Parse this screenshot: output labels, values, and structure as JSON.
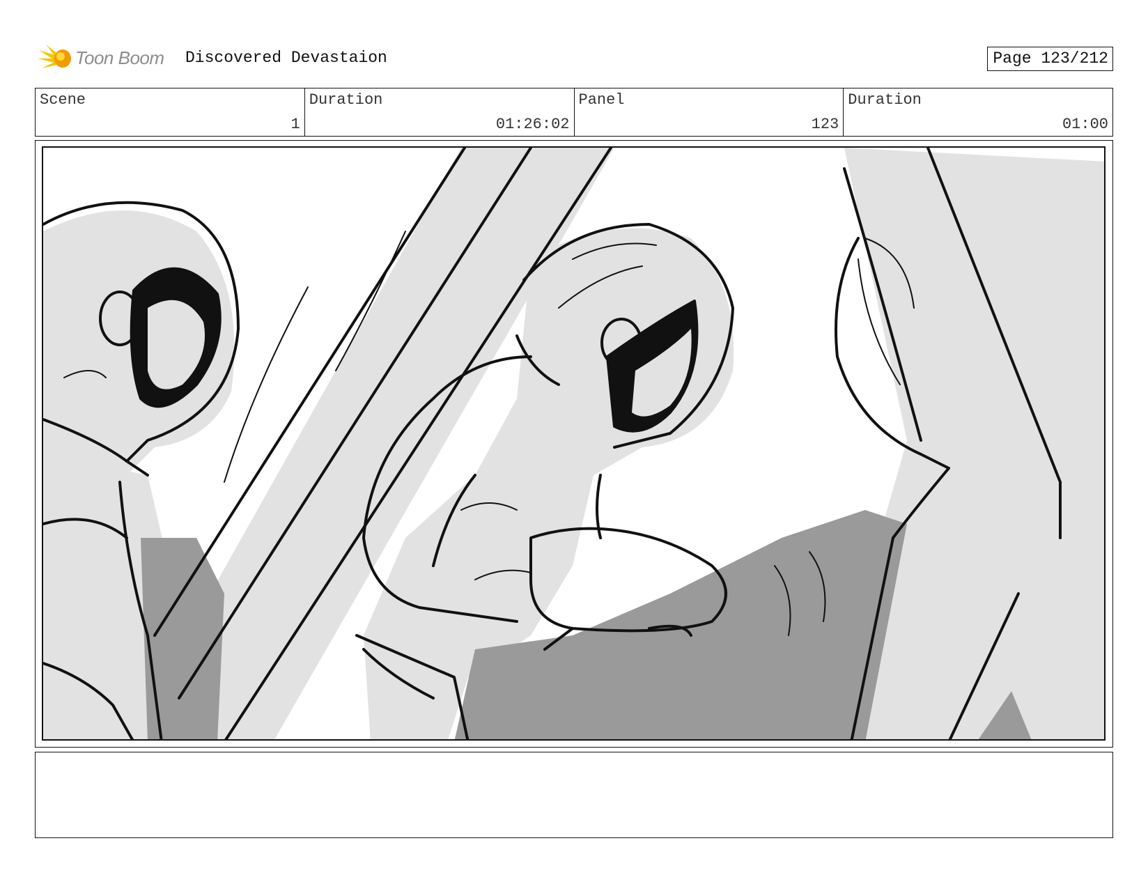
{
  "header": {
    "logo_text": "Toon Boom",
    "title": "Discovered Devastaion",
    "page_label": "Page 123/212"
  },
  "info": {
    "scene": {
      "label": "Scene",
      "value": "1"
    },
    "scene_duration": {
      "label": "Duration",
      "value": "01:26:02"
    },
    "panel": {
      "label": "Panel",
      "value": "123"
    },
    "panel_duration": {
      "label": "Duration",
      "value": "01:00"
    }
  },
  "panel_image": {
    "description_icon": "storyboard-sketch",
    "colors": {
      "light_gray": "#e2e2e2",
      "dark_gray": "#9a9a9a",
      "ink": "#111111"
    }
  },
  "notes": {
    "text": ""
  }
}
